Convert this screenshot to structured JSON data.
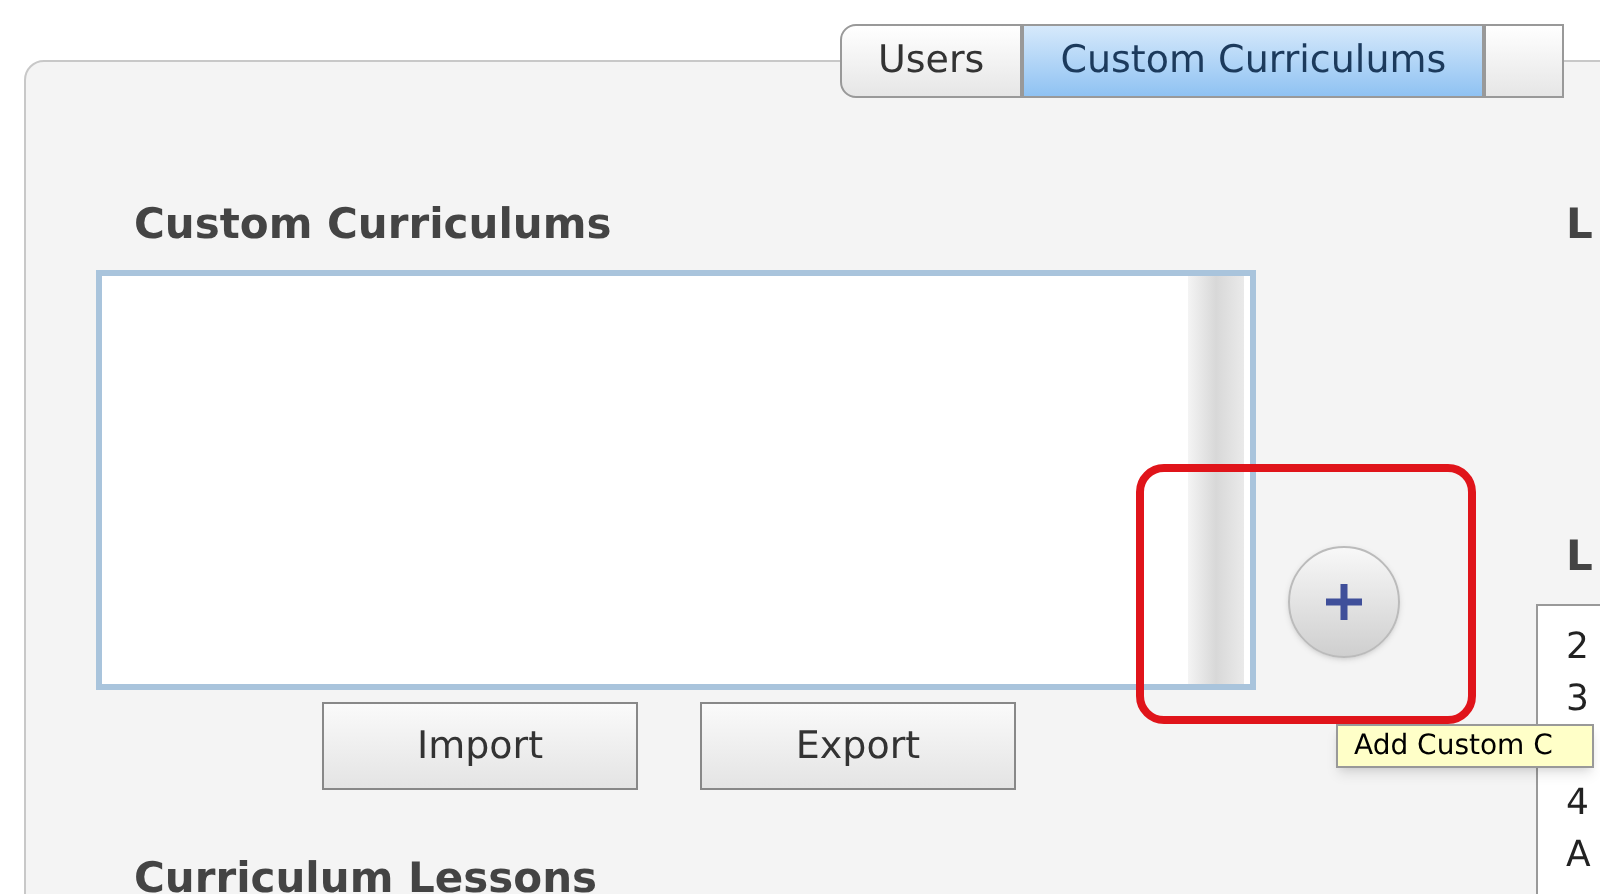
{
  "tabs": [
    {
      "label": "Users",
      "selected": false
    },
    {
      "label": "Custom Curriculums",
      "selected": true
    }
  ],
  "custom_curriculums": {
    "heading": "Custom Curriculums",
    "buttons": [
      "Import",
      "Export"
    ]
  },
  "add_button": {
    "tooltip": "Add Custom C"
  },
  "right_column": {
    "heading_1": "L",
    "heading_2": "L",
    "list_items": [
      "2",
      "3",
      "4",
      "A"
    ]
  },
  "curriculum_lessons": {
    "heading": "Curriculum Lessons"
  }
}
